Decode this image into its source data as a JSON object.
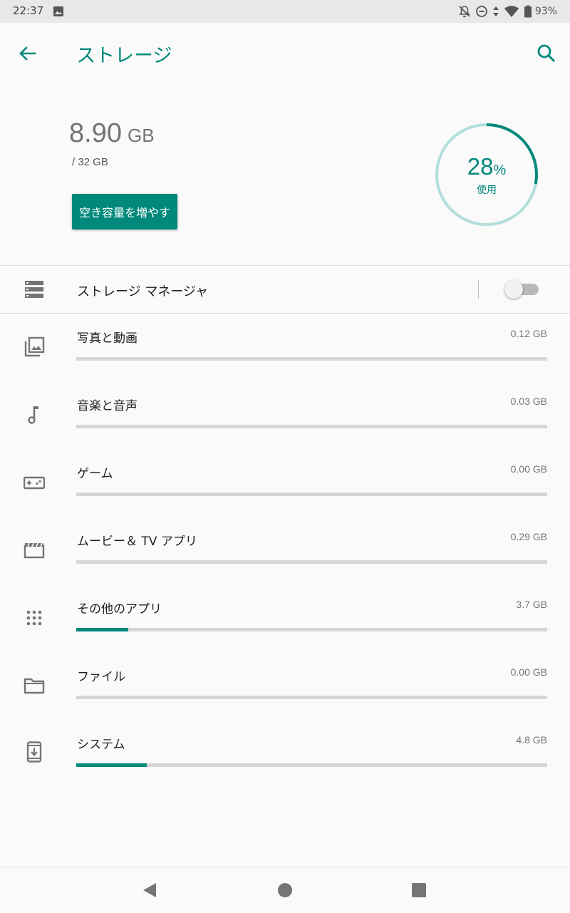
{
  "status_bar": {
    "time": "22:37",
    "battery_text": "93%",
    "icons": [
      "image-notification-icon",
      "bell-off-icon",
      "do-not-disturb-icon",
      "data-arrows-icon",
      "wifi-icon",
      "battery-icon"
    ]
  },
  "app_bar": {
    "title": "ストレージ",
    "back_icon": "arrow-back-icon",
    "search_icon": "search-icon"
  },
  "summary": {
    "used_value": "8.90",
    "used_unit": "GB",
    "total": "/ 32 GB",
    "free_up_label": "空き容量を増やす",
    "percent_value": "28",
    "percent_sign": "%",
    "percent_label": "使用",
    "percent_fraction": 0.28
  },
  "storage_manager": {
    "label": "ストレージ マネージャ",
    "icon": "storage-icon",
    "enabled": false
  },
  "categories": [
    {
      "label": "写真と動画",
      "size": "0.12 GB",
      "icon": "photo-library-icon",
      "fraction": 0.0
    },
    {
      "label": "音楽と音声",
      "size": "0.03 GB",
      "icon": "music-note-icon",
      "fraction": 0.0
    },
    {
      "label": "ゲーム",
      "size": "0.00 GB",
      "icon": "gamepad-icon",
      "fraction": 0.0
    },
    {
      "label": "ムービー＆ TV アプリ",
      "size": "0.29 GB",
      "icon": "movie-icon",
      "fraction": 0.0
    },
    {
      "label": "その他のアプリ",
      "size": "3.7 GB",
      "icon": "apps-grid-icon",
      "fraction": 0.11
    },
    {
      "label": "ファイル",
      "size": "0.00 GB",
      "icon": "folder-icon",
      "fraction": 0.0
    },
    {
      "label": "システム",
      "size": "4.8 GB",
      "icon": "system-update-icon",
      "fraction": 0.15
    }
  ],
  "nav_bar": {
    "icons": [
      "nav-back-icon",
      "nav-home-icon",
      "nav-recents-icon"
    ]
  },
  "colors": {
    "accent": "#00897b",
    "accent_light": "#b2dfdb",
    "bar_track": "#d6d6d6"
  }
}
